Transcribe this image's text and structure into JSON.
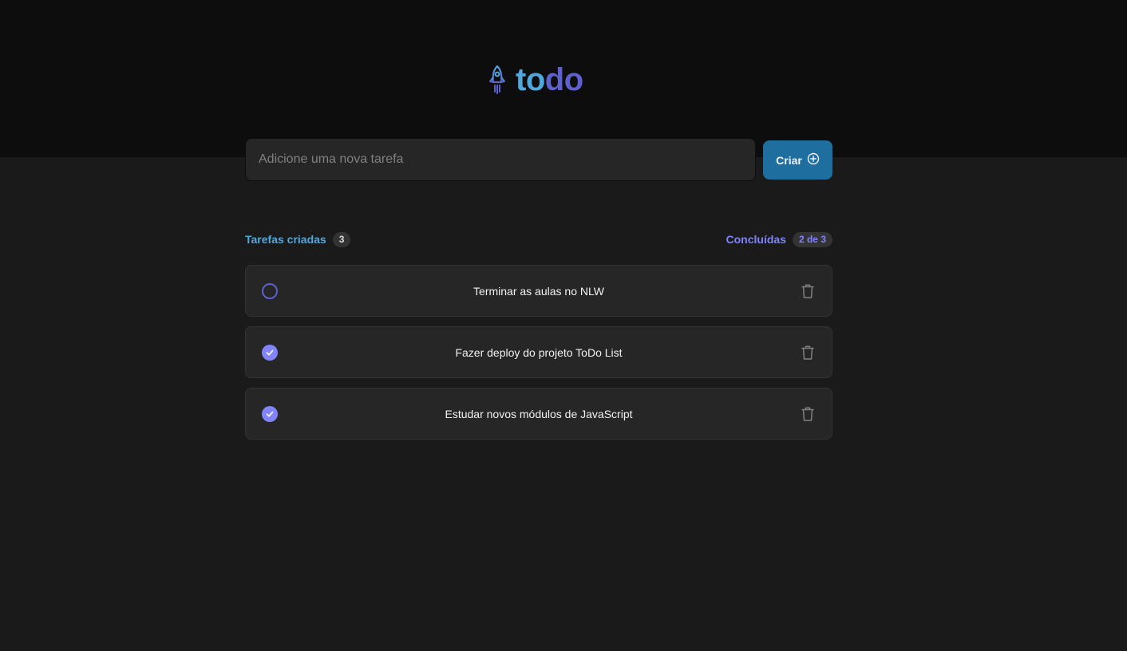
{
  "app": {
    "logo": {
      "part1": "to",
      "part2": "do",
      "icon": "rocket-icon"
    }
  },
  "input": {
    "placeholder": "Adicione uma nova tarefa",
    "value": ""
  },
  "create_button": {
    "label": "Criar",
    "icon": "plus-circle-icon"
  },
  "stats": {
    "created_label": "Tarefas criadas",
    "created_count": "3",
    "done_label": "Concluídas",
    "done_count": "2 de 3"
  },
  "tasks": [
    {
      "text": "Terminar as aulas no NLW",
      "done": false
    },
    {
      "text": "Fazer deploy do projeto ToDo List",
      "done": true
    },
    {
      "text": "Estudar novos módulos de JavaScript",
      "done": true
    }
  ],
  "colors": {
    "blue": "#4ea8de",
    "purple": "#5e60ce",
    "purple_light": "#8284fa",
    "button": "#1e6f9f",
    "background": "#1a1a1a",
    "header_bg": "#0d0d0d"
  }
}
